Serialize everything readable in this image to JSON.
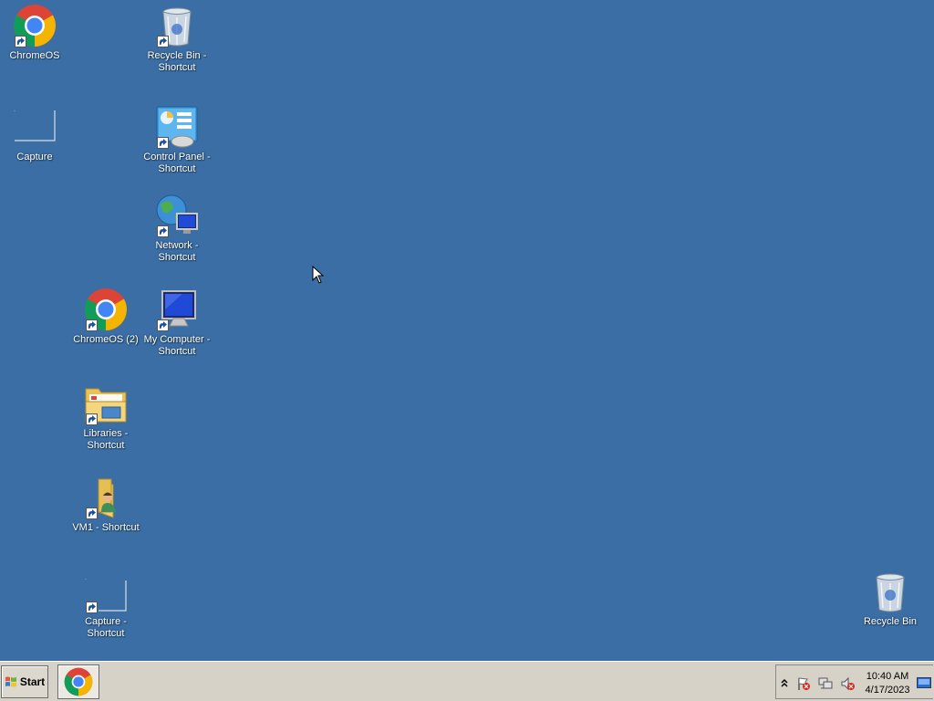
{
  "desktop": {
    "background_color": "#3a6ea5",
    "icons": [
      {
        "id": "chromeos",
        "label": "ChromeOS",
        "icon": "chrome-icon",
        "shortcut": true
      },
      {
        "id": "recycle-bin-shortcut",
        "label": "Recycle Bin -\nShortcut",
        "icon": "recycle-bin-icon",
        "shortcut": true
      },
      {
        "id": "capture",
        "label": "Capture",
        "icon": "capture-icon",
        "shortcut": false
      },
      {
        "id": "control-panel-shortcut",
        "label": "Control Panel -\nShortcut",
        "icon": "control-panel-icon",
        "shortcut": true
      },
      {
        "id": "network-shortcut",
        "label": "Network -\nShortcut",
        "icon": "network-icon",
        "shortcut": true
      },
      {
        "id": "chromeos-2",
        "label": "ChromeOS (2)",
        "icon": "chrome-icon",
        "shortcut": true
      },
      {
        "id": "my-computer-shortcut",
        "label": "My Computer -\nShortcut",
        "icon": "computer-icon",
        "shortcut": true
      },
      {
        "id": "libraries-shortcut",
        "label": "Libraries -\nShortcut",
        "icon": "libraries-folder-icon",
        "shortcut": true
      },
      {
        "id": "vm1-shortcut",
        "label": "VM1 - Shortcut",
        "icon": "user-folder-icon",
        "shortcut": true
      },
      {
        "id": "capture-shortcut",
        "label": "Capture -\nShortcut",
        "icon": "capture-icon",
        "shortcut": true
      },
      {
        "id": "recycle-bin",
        "label": "Recycle Bin",
        "icon": "recycle-bin-icon",
        "shortcut": false
      }
    ]
  },
  "taskbar": {
    "start_label": "Start",
    "pinned": [
      {
        "name": "chrome",
        "icon": "chrome-icon"
      }
    ],
    "tray": {
      "icons": [
        "show-hidden-icons-icon",
        "action-center-flag-icon",
        "network-status-icon",
        "volume-muted-icon"
      ],
      "time": "10:40 AM",
      "date": "4/17/2023"
    }
  }
}
